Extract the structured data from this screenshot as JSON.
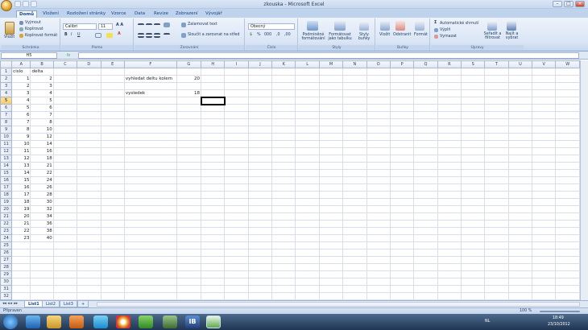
{
  "window": {
    "title": "zkouska - Microsoft Excel"
  },
  "ribbon_tabs": [
    "Domů",
    "Vložení",
    "Rozložení stránky",
    "Vzorce",
    "Data",
    "Revize",
    "Zobrazení",
    "Vývojář"
  ],
  "ribbon": {
    "clipboard": {
      "paste": "Vložit",
      "cut": "Vyjmout",
      "copy": "Kopírovat",
      "format_painter": "Kopírovat formát",
      "label": "Schránka"
    },
    "font": {
      "name": "Calibri",
      "size": "11",
      "label": "Písmo"
    },
    "alignment": {
      "wrap": "Zalamovat text",
      "merge": "Sloučit a zarovnat na střed",
      "label": "Zarovnání"
    },
    "number": {
      "format": "Obecný",
      "label": "Číslo"
    },
    "styles": {
      "conditional": "Podmíněné formátování",
      "as_table": "Formátovat jako tabulku",
      "cell_styles": "Styly buňky",
      "label": "Styly"
    },
    "cells": {
      "insert": "Vložit",
      "delete": "Odstranit",
      "format": "Formát",
      "label": "Buňky"
    },
    "editing": {
      "autosum": "Automatické shrnutí",
      "fill": "Výplň",
      "clear": "Vymazat",
      "sort": "Seřadit a filtrovat",
      "find": "Najít a vybrat",
      "label": "Úpravy"
    }
  },
  "formula_bar": {
    "name_box": "H5",
    "fx": "fx",
    "content": ""
  },
  "columns": [
    "A",
    "B",
    "C",
    "D",
    "E",
    "F",
    "G",
    "H",
    "I",
    "J",
    "K",
    "L",
    "M",
    "N",
    "O",
    "P",
    "Q",
    "R",
    "S",
    "T",
    "U",
    "V",
    "W"
  ],
  "rows": [
    [
      "cislo",
      "delta",
      "",
      "",
      "",
      "",
      "",
      ""
    ],
    [
      "1",
      "2",
      "",
      "",
      "",
      "vyhledat deltu kolem",
      "20",
      ""
    ],
    [
      "2",
      "3",
      "",
      "",
      "",
      "",
      "",
      ""
    ],
    [
      "3",
      "4",
      "",
      "",
      "",
      "vysledek",
      "18",
      ""
    ],
    [
      "4",
      "5",
      "",
      "",
      "",
      "",
      "",
      ""
    ],
    [
      "5",
      "6",
      "",
      "",
      "",
      "",
      "",
      ""
    ],
    [
      "6",
      "7",
      "",
      "",
      "",
      "",
      "",
      ""
    ],
    [
      "7",
      "8",
      "",
      "",
      "",
      "",
      "",
      ""
    ],
    [
      "8",
      "10",
      "",
      "",
      "",
      "",
      "",
      ""
    ],
    [
      "9",
      "12",
      "",
      "",
      "",
      "",
      "",
      ""
    ],
    [
      "10",
      "14",
      "",
      "",
      "",
      "",
      "",
      ""
    ],
    [
      "11",
      "16",
      "",
      "",
      "",
      "",
      "",
      ""
    ],
    [
      "12",
      "18",
      "",
      "",
      "",
      "",
      "",
      ""
    ],
    [
      "13",
      "21",
      "",
      "",
      "",
      "",
      "",
      ""
    ],
    [
      "14",
      "22",
      "",
      "",
      "",
      "",
      "",
      ""
    ],
    [
      "15",
      "24",
      "",
      "",
      "",
      "",
      "",
      ""
    ],
    [
      "16",
      "26",
      "",
      "",
      "",
      "",
      "",
      ""
    ],
    [
      "17",
      "28",
      "",
      "",
      "",
      "",
      "",
      ""
    ],
    [
      "18",
      "30",
      "",
      "",
      "",
      "",
      "",
      ""
    ],
    [
      "19",
      "32",
      "",
      "",
      "",
      "",
      "",
      ""
    ],
    [
      "20",
      "34",
      "",
      "",
      "",
      "",
      "",
      ""
    ],
    [
      "21",
      "36",
      "",
      "",
      "",
      "",
      "",
      ""
    ],
    [
      "22",
      "38",
      "",
      "",
      "",
      "",
      "",
      ""
    ],
    [
      "23",
      "40",
      "",
      "",
      "",
      "",
      "",
      ""
    ],
    [
      "",
      "",
      "",
      "",
      "",
      "",
      "",
      ""
    ],
    [
      "",
      "",
      "",
      "",
      "",
      "",
      "",
      ""
    ],
    [
      "",
      "",
      "",
      "",
      "",
      "",
      "",
      ""
    ],
    [
      "",
      "",
      "",
      "",
      "",
      "",
      "",
      ""
    ],
    [
      "",
      "",
      "",
      "",
      "",
      "",
      "",
      ""
    ],
    [
      "",
      "",
      "",
      "",
      "",
      "",
      "",
      ""
    ],
    [
      "",
      "",
      "",
      "",
      "",
      "",
      "",
      ""
    ],
    [
      "",
      "",
      "",
      "",
      "",
      "",
      "",
      ""
    ]
  ],
  "sheets": [
    "List1",
    "List2",
    "List3"
  ],
  "status": {
    "mode": "Připraven",
    "zoom": "100 %"
  },
  "taskbar": {
    "lang": "NL",
    "time": "18:49",
    "date": "23/10/2012"
  },
  "colors": {
    "accent": "#15428b",
    "selection": "#f8c965"
  }
}
